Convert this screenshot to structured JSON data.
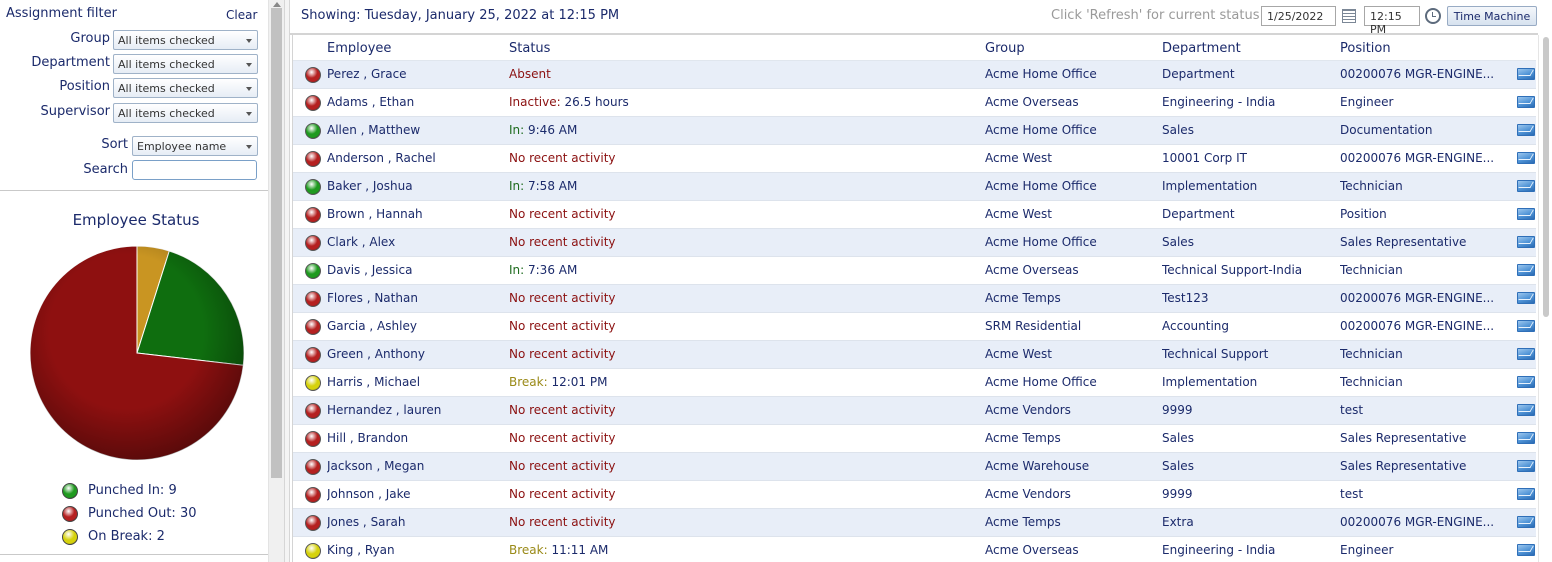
{
  "colors": {
    "text": "#1b2a6b",
    "absent": "#8b1010",
    "inactive": "#8b1010",
    "in": "#1e6b1e",
    "break": "#9a8a18",
    "dot_red": "#b52020",
    "dot_green": "#1f9a1f",
    "dot_yellow": "#d6d20c",
    "pie_red": "#8e1010",
    "pie_green": "#0f6e0f",
    "pie_yellow": "#c99522"
  },
  "filter": {
    "title": "Assignment filter",
    "clear_label": "Clear",
    "group_label": "Group",
    "group_value": "All items checked",
    "department_label": "Department",
    "department_value": "All items checked",
    "position_label": "Position",
    "position_value": "All items checked",
    "supervisor_label": "Supervisor",
    "supervisor_value": "All items checked",
    "sort_label": "Sort",
    "sort_value": "Employee name",
    "search_label": "Search",
    "search_value": ""
  },
  "chart_data": {
    "type": "pie",
    "title": "Employee Status",
    "categories": [
      "Punched In",
      "Punched Out",
      "On Break"
    ],
    "values": [
      9,
      30,
      2
    ],
    "colors": [
      "#0f6e0f",
      "#8e1010",
      "#c99522"
    ],
    "legend_position": "bottom"
  },
  "legend": [
    {
      "label": "Punched In: 9",
      "color": "#1f9a1f"
    },
    {
      "label": "Punched Out: 30",
      "color": "#b52020"
    },
    {
      "label": "On Break: 2",
      "color": "#d6d20c"
    }
  ],
  "header": {
    "showing": "Showing: Tuesday, January 25, 2022 at 12:15 PM",
    "refresh_hint": "Click 'Refresh' for current status",
    "date_value": "1/25/2022",
    "time_value": "12:15 PM",
    "time_machine_label": "Time Machine"
  },
  "columns": {
    "employee": "Employee",
    "status": "Status",
    "group": "Group",
    "department": "Department",
    "position": "Position"
  },
  "rows": [
    {
      "dot": "red",
      "employee": "Perez , Grace",
      "status_label": "Absent",
      "status_value": "",
      "status_kind": "absent",
      "group": "Acme Home Office",
      "department": "Department",
      "position": "00200076 MGR-ENGINE..."
    },
    {
      "dot": "red",
      "employee": "Adams , Ethan",
      "status_label": "Inactive:",
      "status_value": " 26.5 hours",
      "status_kind": "inactive",
      "group": "Acme Overseas",
      "department": "Engineering - India",
      "position": "Engineer"
    },
    {
      "dot": "green",
      "employee": "Allen , Matthew",
      "status_label": "In:",
      "status_value": " 9:46 AM",
      "status_kind": "in",
      "group": "Acme Home Office",
      "department": "Sales",
      "position": "Documentation"
    },
    {
      "dot": "red",
      "employee": "Anderson , Rachel",
      "status_label": "No recent activity",
      "status_value": "",
      "status_kind": "absent",
      "group": "Acme West",
      "department": "10001 Corp IT",
      "position": "00200076 MGR-ENGINE..."
    },
    {
      "dot": "green",
      "employee": "Baker , Joshua",
      "status_label": "In:",
      "status_value": " 7:58 AM",
      "status_kind": "in",
      "group": "Acme Home Office",
      "department": "Implementation",
      "position": "Technician"
    },
    {
      "dot": "red",
      "employee": "Brown , Hannah",
      "status_label": "No recent activity",
      "status_value": "",
      "status_kind": "absent",
      "group": "Acme West",
      "department": "Department",
      "position": "Position"
    },
    {
      "dot": "red",
      "employee": "Clark , Alex",
      "status_label": "No recent activity",
      "status_value": "",
      "status_kind": "absent",
      "group": "Acme Home Office",
      "department": "Sales",
      "position": "Sales Representative"
    },
    {
      "dot": "green",
      "employee": "Davis , Jessica",
      "status_label": "In:",
      "status_value": " 7:36 AM",
      "status_kind": "in",
      "group": "Acme Overseas",
      "department": "Technical Support-India",
      "position": "Technician"
    },
    {
      "dot": "red",
      "employee": "Flores , Nathan",
      "status_label": "No recent activity",
      "status_value": "",
      "status_kind": "absent",
      "group": "Acme Temps",
      "department": "Test123",
      "position": "00200076 MGR-ENGINE..."
    },
    {
      "dot": "red",
      "employee": "Garcia , Ashley",
      "status_label": "No recent activity",
      "status_value": "",
      "status_kind": "absent",
      "group": "SRM Residential",
      "department": "Accounting",
      "position": "00200076 MGR-ENGINE..."
    },
    {
      "dot": "red",
      "employee": "Green , Anthony",
      "status_label": "No recent activity",
      "status_value": "",
      "status_kind": "absent",
      "group": "Acme West",
      "department": "Technical Support",
      "position": "Technician"
    },
    {
      "dot": "yellow",
      "employee": "Harris , Michael",
      "status_label": "Break:",
      "status_value": " 12:01 PM",
      "status_kind": "break",
      "group": "Acme Home Office",
      "department": "Implementation",
      "position": "Technician"
    },
    {
      "dot": "red",
      "employee": "Hernandez , lauren",
      "status_label": "No recent activity",
      "status_value": "",
      "status_kind": "absent",
      "group": "Acme Vendors",
      "department": "9999",
      "position": "test"
    },
    {
      "dot": "red",
      "employee": "Hill , Brandon",
      "status_label": "No recent activity",
      "status_value": "",
      "status_kind": "absent",
      "group": "Acme Temps",
      "department": "Sales",
      "position": "Sales Representative"
    },
    {
      "dot": "red",
      "employee": "Jackson , Megan",
      "status_label": "No recent activity",
      "status_value": "",
      "status_kind": "absent",
      "group": "Acme Warehouse",
      "department": "Sales",
      "position": "Sales Representative"
    },
    {
      "dot": "red",
      "employee": "Johnson , Jake",
      "status_label": "No recent activity",
      "status_value": "",
      "status_kind": "absent",
      "group": "Acme Vendors",
      "department": "9999",
      "position": "test"
    },
    {
      "dot": "red",
      "employee": "Jones , Sarah",
      "status_label": "No recent activity",
      "status_value": "",
      "status_kind": "absent",
      "group": "Acme Temps",
      "department": "Extra",
      "position": "00200076 MGR-ENGINE..."
    },
    {
      "dot": "yellow",
      "employee": "King , Ryan",
      "status_label": "Break:",
      "status_value": " 11:11 AM",
      "status_kind": "break",
      "group": "Acme Overseas",
      "department": "Engineering - India",
      "position": "Engineer"
    }
  ]
}
